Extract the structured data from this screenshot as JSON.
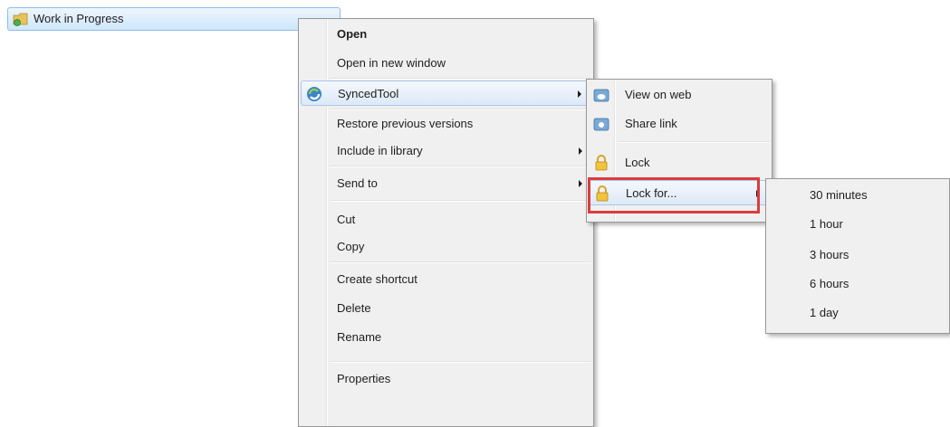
{
  "folder": {
    "label": "Work in Progress",
    "icon": "folder-sync-icon"
  },
  "main_menu": {
    "open": "Open",
    "open_new_window": "Open in new window",
    "syncedtool": "SyncedTool",
    "restore": "Restore previous versions",
    "include_library": "Include in library",
    "send_to": "Send to",
    "cut": "Cut",
    "copy": "Copy",
    "create_shortcut": "Create shortcut",
    "delete": "Delete",
    "rename": "Rename",
    "properties": "Properties"
  },
  "synced_menu": {
    "view_on_web": "View on web",
    "share_link": "Share link",
    "lock": "Lock",
    "lock_for": "Lock for..."
  },
  "lockfor_menu": {
    "items": [
      "30 minutes",
      "1 hour",
      "3 hours",
      "6 hours",
      "1 day"
    ]
  },
  "colors": {
    "highlight_box": "#dc3c3c",
    "selection": "#cfe6fb"
  }
}
